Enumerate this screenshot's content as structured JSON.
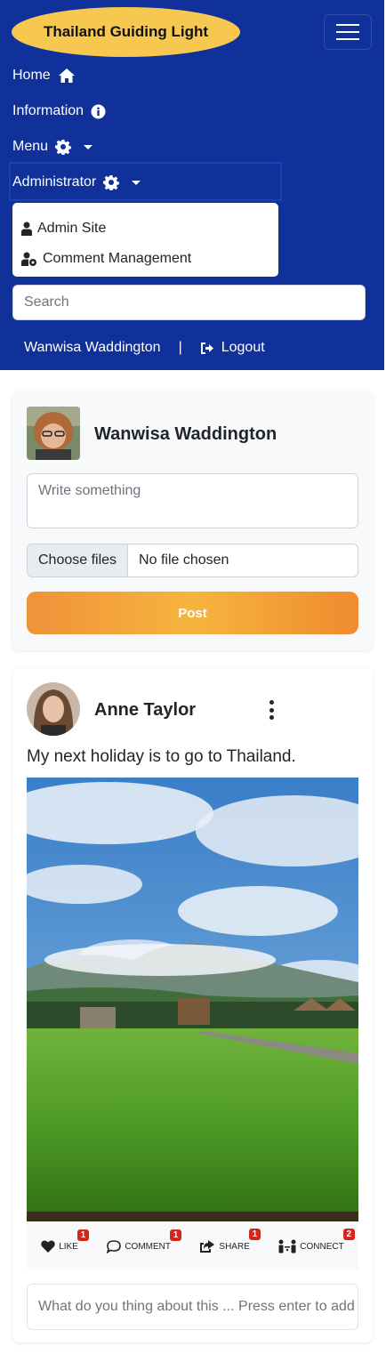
{
  "navbar": {
    "brand": "Thailand Guiding Light",
    "items": [
      {
        "label": "Home",
        "icon": "home-icon"
      },
      {
        "label": "Information",
        "icon": "info-icon"
      },
      {
        "label": "Menu",
        "icon": "gear-icon"
      },
      {
        "label": "Administrator",
        "icon": "gear-icon"
      }
    ],
    "dropdown": [
      {
        "label": "Admin Site",
        "icon": "user-icon"
      },
      {
        "label": "Comment Management",
        "icon": "user-gear-icon"
      }
    ],
    "search_placeholder": "Search",
    "user_name": "Wanwisa Waddington",
    "separator": "|",
    "logout_label": "Logout"
  },
  "post_form": {
    "user_name": "Wanwisa Waddington",
    "textarea_placeholder": "Write something",
    "file_button": "Choose files",
    "file_status": "No file chosen",
    "post_button": "Post"
  },
  "feed": {
    "author": "Anne Taylor",
    "text": "My next holiday is to go to Thailand.",
    "actions": [
      {
        "label": "LIKE",
        "count": "1",
        "icon": "heart-icon"
      },
      {
        "label": "COMMENT",
        "count": "1",
        "icon": "comment-icon"
      },
      {
        "label": "SHARE",
        "count": "1",
        "icon": "share-icon"
      },
      {
        "label": "CONNECT",
        "count": "2",
        "icon": "connect-icon"
      }
    ],
    "comment_placeholder": "What do you thing about this ... Press enter to add"
  },
  "colors": {
    "navbar": "#10309a",
    "brand_bg": "#f7c850",
    "post_button": "#f0923a",
    "badge": "#d6261c"
  }
}
